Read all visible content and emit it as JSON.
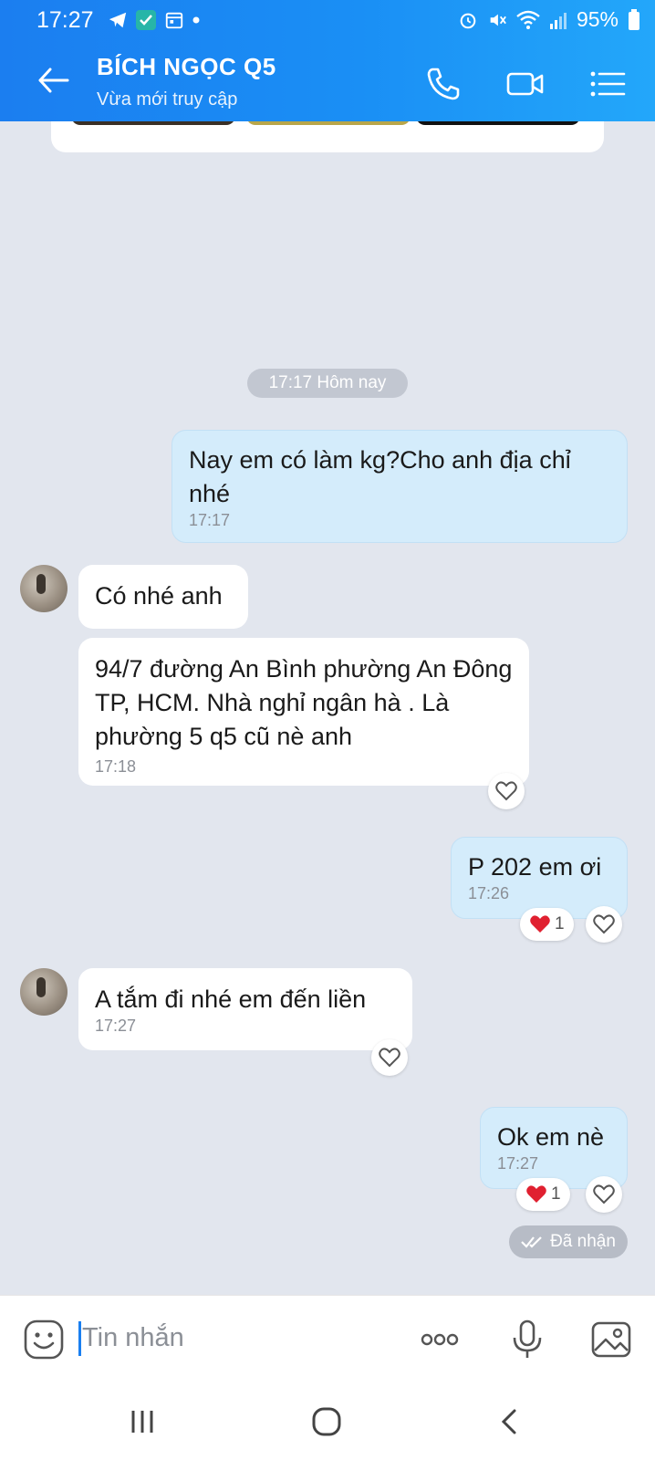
{
  "status_bar": {
    "time": "17:27",
    "battery": "95%"
  },
  "header": {
    "contact_name": "BÍCH NGỌC Q5",
    "contact_status": "Vừa mới truy cập"
  },
  "chat": {
    "date_chip": "17:17 Hôm nay",
    "messages": [
      {
        "direction": "out",
        "text": "Nay em có làm kg?Cho anh địa chỉ nhé",
        "time": "17:17"
      },
      {
        "direction": "in",
        "text": "Có nhé anh",
        "time": ""
      },
      {
        "direction": "in",
        "text": "94/7 đường An Bình phường An Đông TP, HCM. Nhà nghỉ ngân hà . Là phường 5 q5 cũ nè anh",
        "time": "17:18"
      },
      {
        "direction": "out",
        "text": "P 202 em ơi",
        "time": "17:26",
        "reaction_count": "1"
      },
      {
        "direction": "in",
        "text": "A tắm đi nhé em đến liền",
        "time": "17:27"
      },
      {
        "direction": "out",
        "text": "Ok em nè",
        "time": "17:27",
        "reaction_count": "1"
      }
    ],
    "seen_label": "Đã nhận"
  },
  "input": {
    "placeholder": "Tin nhắn"
  },
  "colors": {
    "header": "#1a8ff5",
    "outgoing_bubble": "#d4ecfb",
    "incoming_bubble": "#ffffff",
    "chat_bg": "#e2e6ee",
    "heart": "#e02030"
  },
  "icons": [
    "back-arrow-icon",
    "phone-icon",
    "video-icon",
    "list-menu-icon",
    "heart-icon",
    "emoji-icon",
    "more-icon",
    "mic-icon",
    "image-icon"
  ]
}
